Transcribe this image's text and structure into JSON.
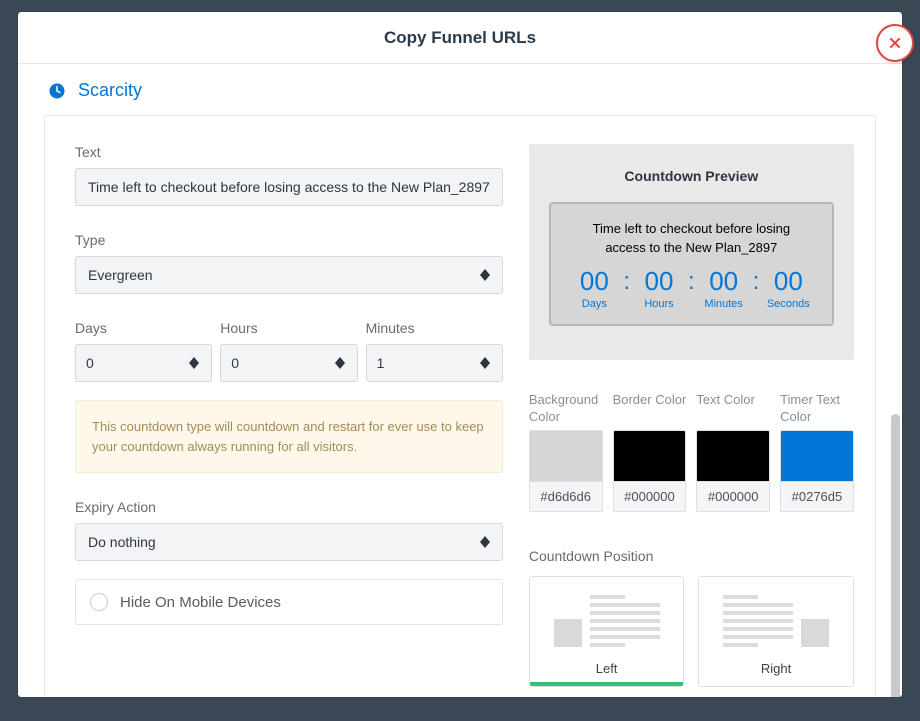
{
  "modal": {
    "title": "Copy Funnel URLs"
  },
  "section": {
    "icon": "clock-icon",
    "title": "Scarcity"
  },
  "form": {
    "text_label": "Text",
    "text_value": "Time left to checkout before losing access to the New Plan_2897",
    "type_label": "Type",
    "type_value": "Evergreen",
    "days_label": "Days",
    "days_value": "0",
    "hours_label": "Hours",
    "hours_value": "0",
    "minutes_label": "Minutes",
    "minutes_value": "1",
    "info_text": "This countdown type will countdown and restart for ever use to keep your countdown always running for all visitors.",
    "expiry_label": "Expiry Action",
    "expiry_value": "Do nothing",
    "hide_mobile_label": "Hide On Mobile Devices"
  },
  "preview": {
    "heading": "Countdown Preview",
    "text": "Time left to checkout before losing access to the New Plan_2897",
    "units": [
      {
        "num": "00",
        "label": "Days"
      },
      {
        "num": "00",
        "label": "Hours"
      },
      {
        "num": "00",
        "label": "Minutes"
      },
      {
        "num": "00",
        "label": "Seconds"
      }
    ]
  },
  "colors": {
    "bg": {
      "label": "Background Color",
      "hex": "#d6d6d6"
    },
    "brd": {
      "label": "Border Color",
      "hex": "#000000"
    },
    "txt": {
      "label": "Text Color",
      "hex": "#000000"
    },
    "tmr": {
      "label": "Timer Text Color",
      "hex": "#0276d5"
    }
  },
  "position": {
    "label": "Countdown Position",
    "left": "Left",
    "right": "Right"
  }
}
